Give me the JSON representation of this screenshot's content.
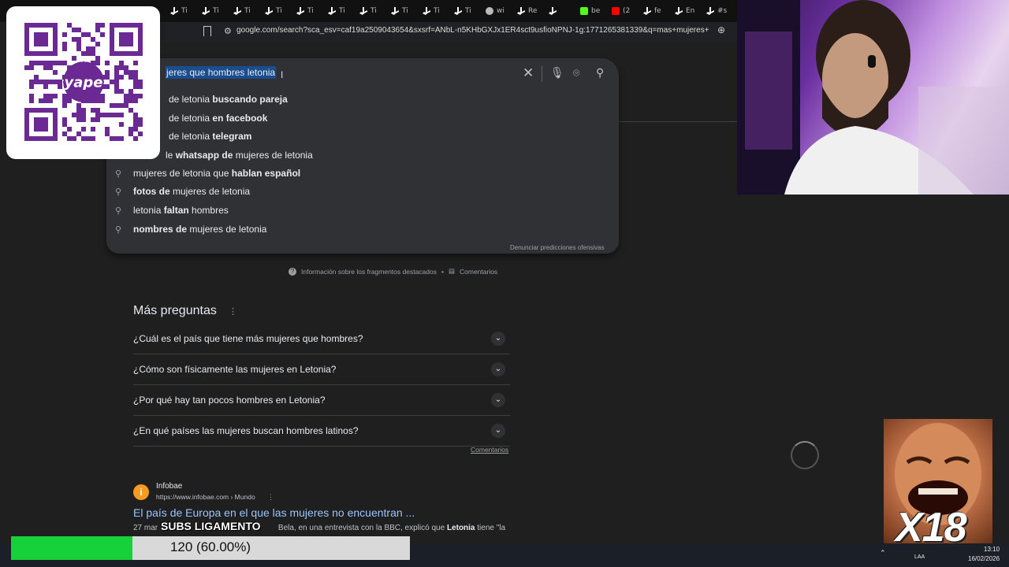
{
  "tabs": [
    {
      "label": "Ti",
      "icon": "tiktok-icon"
    },
    {
      "label": "Ti",
      "icon": "tiktok-icon"
    },
    {
      "label": "Ti",
      "icon": "tiktok-icon"
    },
    {
      "label": "Ti",
      "icon": "tiktok-icon"
    },
    {
      "label": "Ti",
      "icon": "tiktok-icon"
    },
    {
      "label": "Ti",
      "icon": "tiktok-icon"
    },
    {
      "label": "Ti",
      "icon": "tiktok-icon"
    },
    {
      "label": "Ti",
      "icon": "tiktok-icon"
    },
    {
      "label": "Ti",
      "icon": "tiktok-icon"
    },
    {
      "label": "Ti",
      "icon": "tiktok-icon"
    },
    {
      "label": "wi",
      "icon": "globe-icon"
    },
    {
      "label": "Re",
      "icon": "tiktok-icon"
    },
    {
      "label": "",
      "icon": "tiktok-icon"
    },
    {
      "label": "be",
      "icon": "kick-icon"
    },
    {
      "label": "(2",
      "icon": "youtube-icon"
    },
    {
      "label": "fe",
      "icon": "tiktok-icon"
    },
    {
      "label": "En",
      "icon": "tiktok-icon"
    },
    {
      "label": "#s",
      "icon": "tiktok-icon"
    }
  ],
  "address_bar": {
    "url": "google.com/search?sca_esv=caf19a2509043654&sxsrf=ANbL-n5KHbGXJx1ER4sct9usfioNPNJ-1g:1771265381339&q=mas+mujeres+que+hom..."
  },
  "search": {
    "query": "jeres que hombres letonia",
    "suggestions": [
      {
        "pre": "",
        "normal": "de letonia ",
        "bold": "buscando pareja"
      },
      {
        "pre": "",
        "normal": "de letonia ",
        "bold": "en facebook"
      },
      {
        "pre": "",
        "normal": "de letonia ",
        "bold": "telegram"
      },
      {
        "pre": "le ",
        "bold": "whatsapp de ",
        "normal": "mujeres de letonia"
      },
      {
        "pre": "",
        "normal": "mujeres de letonia que ",
        "bold": "hablan español"
      },
      {
        "pre": "",
        "bold": "fotos de ",
        "normal": "mujeres de letonia"
      },
      {
        "pre": "",
        "normal": "letonia ",
        "bold": "faltan",
        "after": " hombres"
      },
      {
        "pre": "",
        "bold": "nombres de ",
        "normal": "mujeres de letonia"
      }
    ],
    "report_link": "Denunciar predicciones ofensivas"
  },
  "snippet_bar": {
    "info": "Información sobre los fragmentos destacados",
    "feedback": "Comentarios"
  },
  "paa": {
    "title": "Más preguntas",
    "questions": [
      "¿Cuál es el país que tiene más mujeres que hombres?",
      "¿Cómo son físicamente las mujeres en Letonia?",
      "¿Por qué hay tan pocos hombres en Letonia?",
      "¿En qué países las mujeres buscan hombres latinos?"
    ],
    "feedback": "Comentarios"
  },
  "result": {
    "site_name": "Infobae",
    "site_url": "https://www.infobae.com › Mundo",
    "title": "El país de Europa en el que las mujeres no encuentran ...",
    "snippet_prefix": "27 mar",
    "snippet_mid": "Bela, en una entrevista con la BBC, explicó que ",
    "snippet_bold": "Letonia",
    "snippet_suffix": " tiene \"la"
  },
  "overlay": {
    "qr_brand": "yape",
    "subs_title": "SUBS LIGAMENTO",
    "subs_count": "120 (60.00%)",
    "subs_progress": 0.6,
    "meme_text": "X18",
    "colors": {
      "progress": "#16d13a",
      "link": "#99c3ff",
      "highlight": "#1a4d8f"
    }
  },
  "taskbar": {
    "time": "13:10",
    "date": "16/02/2026",
    "lang": "LAA"
  }
}
